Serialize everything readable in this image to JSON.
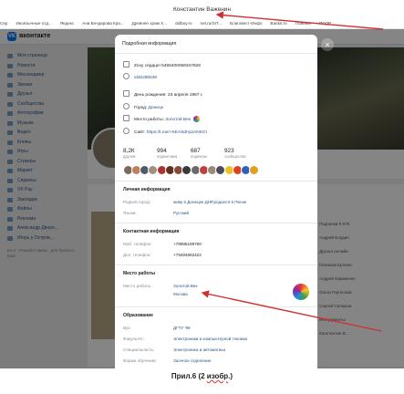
{
  "window": {
    "title": "Константин Важенин"
  },
  "bookmarks": [
    "Сер",
    "Иноязычные отд...",
    "Яндекс",
    "Ани Бочдарова Кра...",
    "Древнее храм Х...",
    "oldboy.ru",
    "net.ru/SIT...",
    "Благовест-Инфо",
    "Banks.ru",
    "Главная",
    "ПОДР"
  ],
  "vk": {
    "logo_text": "VK",
    "brand": "вконтакте",
    "sidebar": [
      "Моя страница",
      "Новости",
      "Мессенджер",
      "Звонки",
      "Друзья",
      "Сообщества",
      "Фотографии",
      "Музыка",
      "Видео",
      "Клипы",
      "Игры",
      "Стикеры",
      "Маркет",
      "Сервисы",
      "VK Pay",
      "Закладки",
      "Файлы",
      "Реклама",
      "Александр Дворе...",
      "Игорь у Остров..."
    ],
    "sidebar_footer": "Блог · Разработчикам · Для бизнеса · Ещё",
    "right_list": [
      "Подписки 8 679",
      "Андрей Блудин",
      "Друзья онлайн",
      "Пахамов Ерохин",
      "Андрей Ефименко",
      "Ольга Гергесова",
      "Сергей Селюков",
      "Инструменты",
      "Константин В."
    ]
  },
  "modal": {
    "title": "Подробная информация",
    "status": "Zоvу сердце! 5469400059347828",
    "user_id": "id45285536",
    "birthday": "День рождения: 23 апреля 1967 г.",
    "city_label": "Город:",
    "city": "Донецк",
    "workplace_label": "Место работы:",
    "workplace": "Золотой Век",
    "site_label": "Сайт:",
    "site": "https://t.me/+KEASdHjiJANKGI",
    "stats": [
      {
        "value": "8,2К",
        "label": "друзей"
      },
      {
        "value": "994",
        "label": "подписчика"
      },
      {
        "value": "687",
        "label": "подписки"
      },
      {
        "value": "923",
        "label": "сообщества"
      }
    ],
    "personal": {
      "title": "Личная информация",
      "hometown_label": "Родной город:",
      "hometown": "живу в Донецке ДНР,родился в Пензе",
      "languages_label": "Языки:",
      "languages": "Русский"
    },
    "contacts": {
      "title": "Контактная информация",
      "mobile_label": "Моб. телефон:",
      "mobile": "+79085199760",
      "home_label": "Доп. телефон:",
      "home": "+79494692422"
    },
    "work": {
      "title": "Место работы",
      "label": "Место работы",
      "company": "Золотой Век",
      "city": "Москва"
    },
    "education": {
      "title": "Образование",
      "uni_label": "Вуз:",
      "uni": "ДГТУ '99",
      "faculty_label": "Факультет:",
      "faculty": "Электроники и компьютерной техники",
      "specialty_label": "Специальность:",
      "specialty": "Электроника и автоматика",
      "form_label": "Форма обучения:",
      "form": "Заочное отделение"
    }
  },
  "caption": {
    "prefix": "Прил.6 (2 ",
    "underlined": "изобр",
    "suffix": ".)"
  },
  "colors": {
    "vk_blue": "#0077ff",
    "link": "#2a5885",
    "arrow": "#d32f2f"
  }
}
